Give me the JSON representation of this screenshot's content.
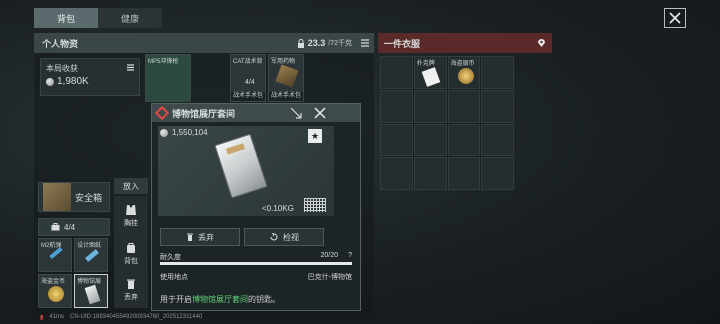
{
  "tabs": [
    {
      "label": "背包",
      "active": true
    },
    {
      "label": "健康",
      "active": false
    }
  ],
  "left_panel": {
    "title": "个人物资",
    "weight_current": "23.3",
    "weight_max": "/72千克",
    "earnings_label": "本局收获",
    "earnings_value": "1,980K",
    "slots": [
      {
        "label": "MP5冲锋枪",
        "sub": ""
      },
      {
        "label": "CAT战术背",
        "sub": "战术手术包",
        "count": "4/4"
      },
      {
        "label": "军用药物",
        "sub": "战术手术包"
      }
    ],
    "safe_label": "安全箱",
    "count_label": "4/4",
    "small_items": [
      {
        "label": "M2航弹"
      },
      {
        "label": "设计图纸"
      },
      {
        "label": "海盗金币"
      },
      {
        "label": "博物馆展"
      }
    ]
  },
  "actions": {
    "put_in": "放入",
    "items": [
      {
        "label": "胸挂",
        "icon": "vest-icon"
      },
      {
        "label": "背包",
        "icon": "backpack-icon"
      },
      {
        "label": "丢弃",
        "icon": "trash-icon"
      }
    ]
  },
  "popup": {
    "title": "博物馆展厅套间",
    "price": "1,550,104",
    "weight": "<0.10KG",
    "discard_label": "丢弃",
    "inspect_label": "检视",
    "durability_label": "耐久度",
    "durability_value": "20/20",
    "durability_fraction": 1.0,
    "use_location_label": "使用地点",
    "use_location_value": "巴克什-博物馆",
    "desc_prefix": "用于开启",
    "desc_highlight": "博物馆展厅套间",
    "desc_suffix": "的钥匙。"
  },
  "right_panel": {
    "title": "一件衣服",
    "items": [
      {
        "label": "扑克牌"
      },
      {
        "label": "海盗银币"
      }
    ]
  },
  "status_bar": {
    "ping": "41ms",
    "uid": "CN-UID:18934045549200934760_202512311440"
  },
  "colors": {
    "accent_red": "#e24a3f",
    "highlight_green": "#5fd37a",
    "right_header": "#5a2a2a"
  }
}
